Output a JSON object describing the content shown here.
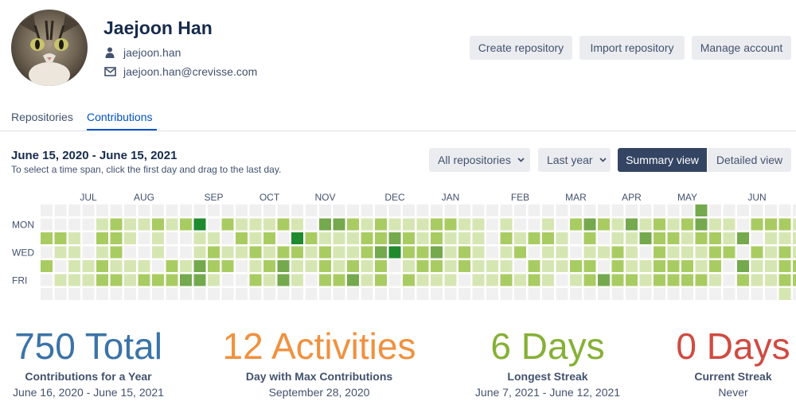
{
  "profile": {
    "avatar_alt": "cat-photo",
    "name": "Jaejoon Han",
    "username": "jaejoon.han",
    "email": "jaejoon.han@crevisse.com"
  },
  "actions": {
    "create": "Create repository",
    "import": "Import repository",
    "manage": "Manage account"
  },
  "tabs": [
    {
      "label": "Repositories",
      "active": false
    },
    {
      "label": "Contributions",
      "active": true
    }
  ],
  "range": {
    "title": "June 15, 2020 - June 15, 2021",
    "hint": "To select a time span, click the first day and drag to the last day."
  },
  "filters": {
    "repositories": "All repositories",
    "period": "Last year"
  },
  "views": {
    "summary": "Summary view",
    "detailed": "Detailed view",
    "selected": "summary"
  },
  "chart_data": {
    "type": "heatmap",
    "months": [
      {
        "label": "JUL",
        "week": 3
      },
      {
        "label": "AUG",
        "week": 7
      },
      {
        "label": "SEP",
        "week": 12
      },
      {
        "label": "OCT",
        "week": 16
      },
      {
        "label": "NOV",
        "week": 20
      },
      {
        "label": "DEC",
        "week": 25
      },
      {
        "label": "JAN",
        "week": 29
      },
      {
        "label": "FEB",
        "week": 34
      },
      {
        "label": "MAR",
        "week": 38
      },
      {
        "label": "APR",
        "week": 42
      },
      {
        "label": "MAY",
        "week": 46
      },
      {
        "label": "JUN",
        "week": 51
      }
    ],
    "day_labels": [
      {
        "label": "MON",
        "row": 1
      },
      {
        "label": "WED",
        "row": 3
      },
      {
        "label": "FRI",
        "row": 5
      }
    ],
    "colors": [
      "#f0f0f0",
      "#d6e6b2",
      "#a9cc62",
      "#74a94d",
      "#1f8a2e"
    ],
    "levels": [
      "0000000000000000000000000000000000000000000000030000000",
      "0000121121240211121033212111221101001023213121231102221",
      "2210221010011021204211122321211102122102011322122130111",
      "0110120010012112122121123422312101201101121021112202121",
      "2011211102132201231121212012212111021122021122212031122",
      "0111221222331002131022312021110112121012322122221021122",
      "0000000000000000000000000000000000000000000000000000010"
    ]
  },
  "stats": [
    {
      "value": "750 Total",
      "label": "Contributions for a Year",
      "sub": "June 16, 2020 - June 15, 2021",
      "color": "#3b73a8"
    },
    {
      "value": "12 Activities",
      "label": "Day with Max Contributions",
      "sub": "September 28, 2020",
      "color": "#f0913f"
    },
    {
      "value": "6 Days",
      "label": "Longest Streak",
      "sub": "June 7, 2021 - June 12, 2021",
      "color": "#86b036"
    },
    {
      "value": "0 Days",
      "label": "Current Streak",
      "sub": "Never",
      "color": "#cf4b42"
    }
  ]
}
